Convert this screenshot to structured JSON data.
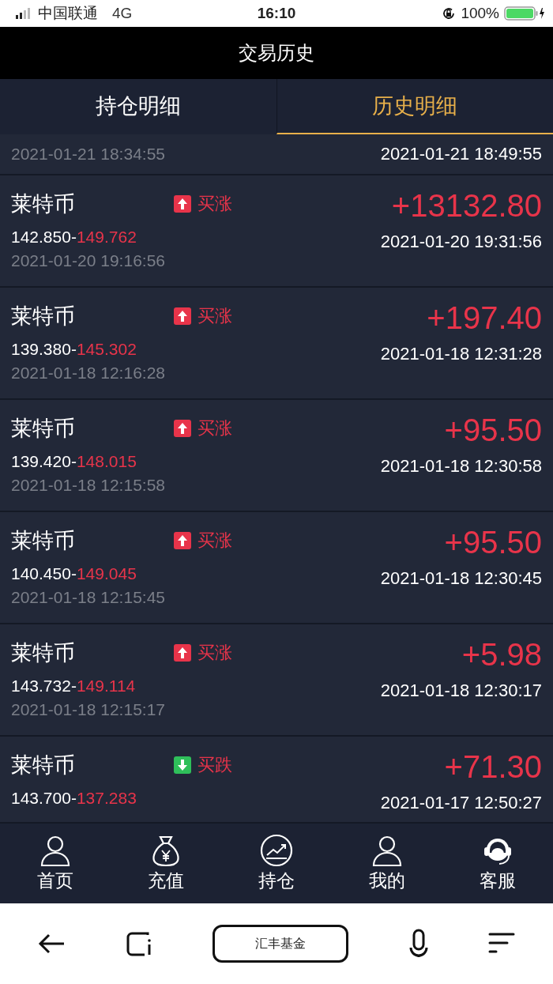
{
  "status_bar": {
    "carrier": "中国联通",
    "network": "4G",
    "time": "16:10",
    "battery": "100%"
  },
  "header": {
    "title": "交易历史"
  },
  "tabs": [
    {
      "label": "持仓明细",
      "selected": false
    },
    {
      "label": "历史明细",
      "selected": true
    }
  ],
  "partial_row": {
    "open_time": "2021-01-21 18:34:55",
    "close_time": "2021-01-21 18:49:55"
  },
  "trades": [
    {
      "name": "莱特币",
      "rising": true,
      "action": "买涨",
      "open_price": "142.850-",
      "close_price": "149.762",
      "open_time": "2021-01-20 19:16:56",
      "profit": "+13132.80",
      "close_time": "2021-01-20 19:31:56"
    },
    {
      "name": "莱特币",
      "rising": true,
      "action": "买涨",
      "open_price": "139.380-",
      "close_price": "145.302",
      "open_time": "2021-01-18 12:16:28",
      "profit": "+197.40",
      "close_time": "2021-01-18 12:31:28"
    },
    {
      "name": "莱特币",
      "rising": true,
      "action": "买涨",
      "open_price": "139.420-",
      "close_price": "148.015",
      "open_time": "2021-01-18 12:15:58",
      "profit": "+95.50",
      "close_time": "2021-01-18 12:30:58"
    },
    {
      "name": "莱特币",
      "rising": true,
      "action": "买涨",
      "open_price": "140.450-",
      "close_price": "149.045",
      "open_time": "2021-01-18 12:15:45",
      "profit": "+95.50",
      "close_time": "2021-01-18 12:30:45"
    },
    {
      "name": "莱特币",
      "rising": true,
      "action": "买涨",
      "open_price": "143.732-",
      "close_price": "149.114",
      "open_time": "2021-01-18 12:15:17",
      "profit": "+5.98",
      "close_time": "2021-01-18 12:30:17"
    },
    {
      "name": "莱特币",
      "rising": false,
      "action": "买跌",
      "open_price": "143.700-",
      "close_price": "137.283",
      "profit": "+71.30",
      "close_time": "2021-01-17 12:50:27"
    }
  ],
  "bottom_nav": [
    {
      "kind": "person",
      "label": "首页"
    },
    {
      "kind": "moneybag",
      "label": "充值"
    },
    {
      "kind": "chart",
      "label": "持仓"
    },
    {
      "kind": "person",
      "label": "我的"
    },
    {
      "kind": "headset",
      "label": "客服"
    }
  ],
  "browser_bar": {
    "address": "汇丰基金"
  }
}
